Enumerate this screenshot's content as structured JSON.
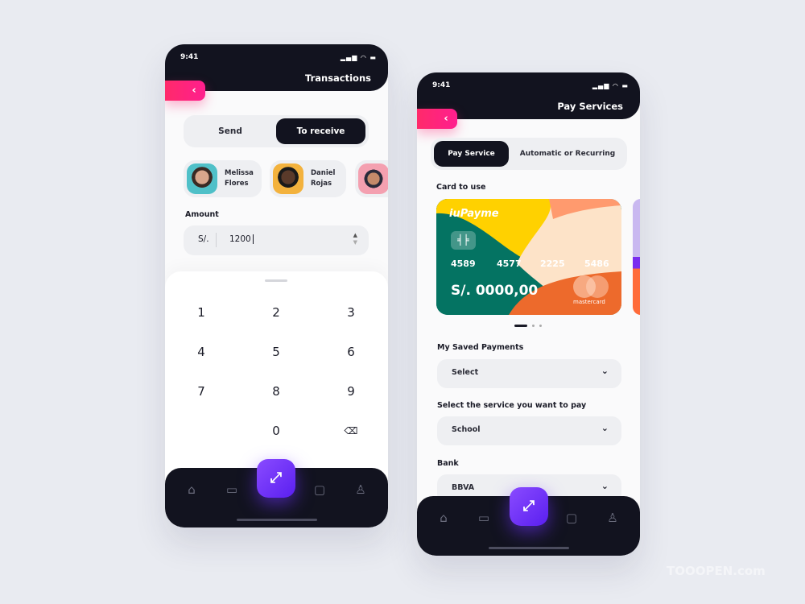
{
  "status_time": "9:41",
  "transactions": {
    "title": "Transactions",
    "back_icon": "chevron-left",
    "tabs": [
      {
        "label": "Send",
        "active": false
      },
      {
        "label": "To receive",
        "active": true
      }
    ],
    "contacts": [
      {
        "first": "Melissa",
        "last": "Flores"
      },
      {
        "first": "Daniel",
        "last": "Rojas"
      },
      {
        "first": "",
        "last": ""
      }
    ],
    "amount_label": "Amount",
    "currency": "S/.",
    "amount_value": "1200",
    "keypad": [
      "1",
      "2",
      "3",
      "4",
      "5",
      "6",
      "7",
      "8",
      "9",
      "0"
    ],
    "backspace_icon": "backspace"
  },
  "pay": {
    "title": "Pay Services",
    "tabs": [
      {
        "label": "Pay Service",
        "active": true
      },
      {
        "label": "Automatic or Recurring",
        "active": false
      }
    ],
    "card_label": "Card to use",
    "card": {
      "brand": "iuPayme",
      "numbers": [
        "4589",
        "4577",
        "2225",
        "5486"
      ],
      "balance": "S/. 0000,00",
      "network": "mastercard"
    },
    "saved_label": "My Saved Payments",
    "saved_value": "Select",
    "service_label": "Select the service you want to pay",
    "service_value": "School",
    "bank_label": "Bank",
    "bank_value": "BBVA"
  },
  "nav_icons": [
    "home",
    "wallet",
    "transfer",
    "chat",
    "profile"
  ],
  "watermark": "TOOOPEN.com",
  "colors": {
    "dark": "#12131f",
    "accent_pink": "#ff1f7a",
    "accent_purple": "#6a2cf5",
    "card_green": "#047362"
  }
}
